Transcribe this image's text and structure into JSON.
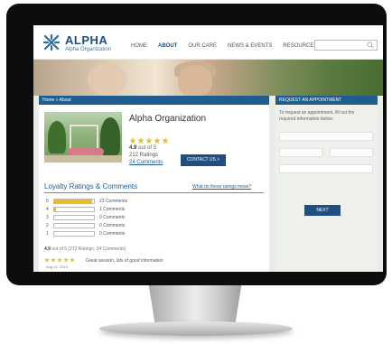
{
  "header": {
    "brand": "ALPHA",
    "brand_sub": "Alpha Organization",
    "logo_icon": "snowflake-logo-icon",
    "nav": [
      "HOME",
      "ABOUT",
      "OUR CARE",
      "NEWS & EVENTS",
      "RESOURCES"
    ],
    "active_nav": "ABOUT",
    "search_icon": "search-icon",
    "search_placeholder": ""
  },
  "breadcrumb": "Home » About",
  "profile": {
    "name": "Alpha Organization",
    "rating_value": "4.9",
    "rating_suffix": "out of 5",
    "stars": 5,
    "ratings_count": "212 Ratings",
    "comments_link": "24 Comments",
    "contact_button": "CONTACT US >"
  },
  "ratings": {
    "title": "Loyalty Ratings & Comments",
    "help_link": "What do these ratings mean?",
    "rows": [
      {
        "star": "5",
        "count": "23 Comments",
        "fill": 0.96
      },
      {
        "star": "4",
        "count": "1 Comments",
        "fill": 0.05
      },
      {
        "star": "3",
        "count": "0 Comments",
        "fill": 0
      },
      {
        "star": "2",
        "count": "0 Comments",
        "fill": 0
      },
      {
        "star": "1",
        "count": "0 Comments",
        "fill": 0
      }
    ],
    "summary_value": "4.9",
    "summary_text": " out of 5  (212 Ratings, 24 Comments)"
  },
  "review": {
    "stars": 5,
    "date": "Aug 22, 2015",
    "text": "Great session, lots of good information"
  },
  "appointment": {
    "title": "REQUEST AN APPOINTMENT",
    "intro": "To request an appointment, fill out the required information below.",
    "next_button": "NEXT"
  },
  "colors": {
    "brand_blue": "#1f5d8f",
    "star_gold": "#f1b91b",
    "rule_green": "#6aa35a"
  }
}
